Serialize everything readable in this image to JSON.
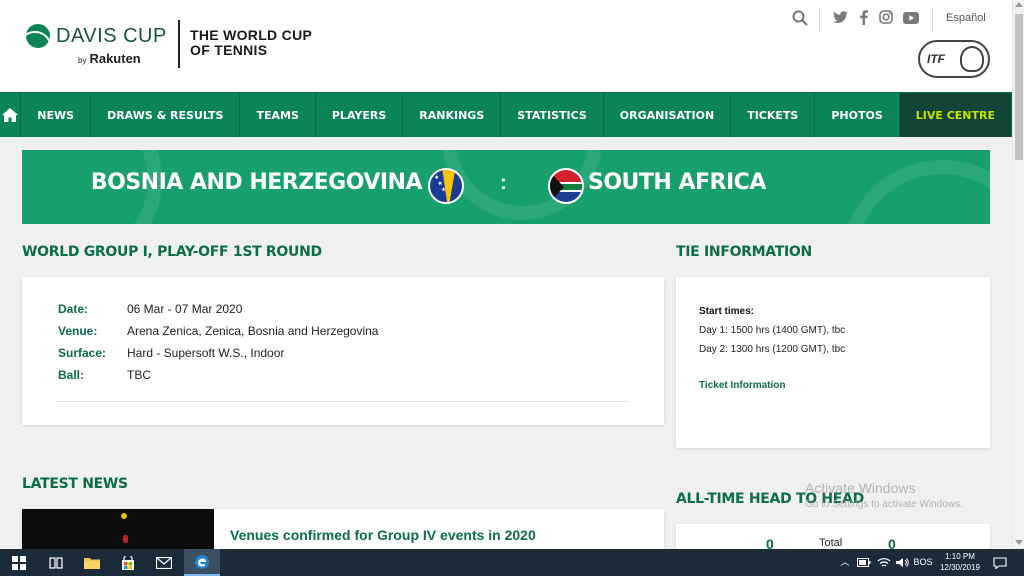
{
  "header": {
    "brand_name": "DAVIS CUP",
    "brand_by": "by",
    "brand_sponsor": "Rakuten",
    "tagline_line1": "THE WORLD CUP",
    "tagline_line2": "OF TENNIS",
    "language": "Español",
    "itf_label": "ITF",
    "icons": [
      "search-icon",
      "twitter-icon",
      "facebook-icon",
      "instagram-icon",
      "youtube-icon"
    ]
  },
  "nav": {
    "home_icon": "home-icon",
    "items": [
      "NEWS",
      "DRAWS & RESULTS",
      "TEAMS",
      "PLAYERS",
      "RANKINGS",
      "STATISTICS",
      "ORGANISATION",
      "TICKETS",
      "PHOTOS",
      "LIVE CENTRE"
    ],
    "active_color": "#c6e300"
  },
  "tie": {
    "team1": "BOSNIA AND HERZEGOVINA",
    "separator": ":",
    "team2": "SOUTH AFRICA",
    "team1_flag": "bosnia-flag-icon",
    "team2_flag": "south-africa-flag-icon"
  },
  "event": {
    "title": "WORLD GROUP I, PLAY-OFF  1ST ROUND",
    "rows": [
      {
        "label": "Date:",
        "value": "06 Mar - 07 Mar 2020"
      },
      {
        "label": "Venue:",
        "value": "Arena Zenica, Zenica, Bosnia and Herzegovina"
      },
      {
        "label": "Surface:",
        "value": "Hard - Supersoft W.S., Indoor"
      },
      {
        "label": "Ball:",
        "value": "TBC"
      }
    ]
  },
  "tie_info": {
    "title": "TIE INFORMATION",
    "start_times_label": "Start times:",
    "day1": "Day 1: 1500 hrs (1400 GMT), tbc",
    "day2": "Day 2: 1300 hrs (1200 GMT), tbc",
    "ticket_link": "Ticket Information"
  },
  "latest_news": {
    "title": "LATEST NEWS",
    "items": [
      {
        "title": "Venues confirmed for Group IV events in 2020"
      }
    ]
  },
  "head_to_head": {
    "title": "ALL-TIME HEAD TO HEAD",
    "team1_wins": "0",
    "label": "Total",
    "team2_wins": "0"
  },
  "watermark": {
    "title": "Activate Windows",
    "subtitle": "Go to Settings to activate Windows."
  },
  "taskbar": {
    "apps": [
      "task-view-icon",
      "file-explorer-icon",
      "store-icon",
      "mail-icon",
      "edge-icon"
    ],
    "tray_lang": "BOS",
    "time": "1:10 PM",
    "date": "12/30/2019",
    "brand_color": "#0b8457"
  }
}
